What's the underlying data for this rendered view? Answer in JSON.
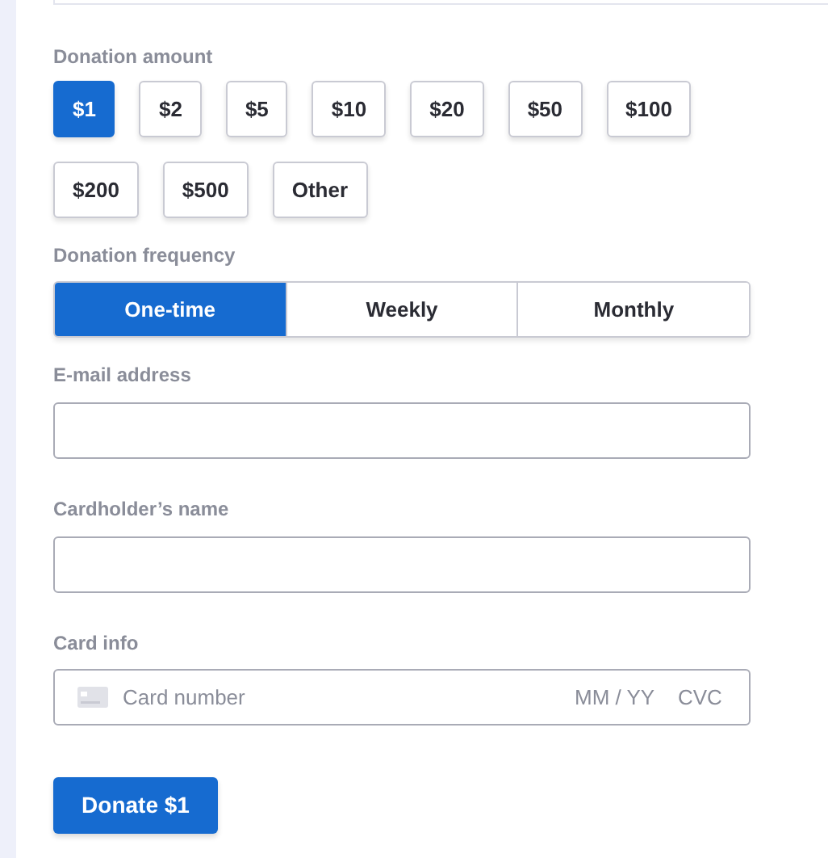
{
  "donation_amount": {
    "label": "Donation amount",
    "options": [
      {
        "label": "$1",
        "selected": true
      },
      {
        "label": "$2",
        "selected": false
      },
      {
        "label": "$5",
        "selected": false
      },
      {
        "label": "$10",
        "selected": false
      },
      {
        "label": "$20",
        "selected": false
      },
      {
        "label": "$50",
        "selected": false
      },
      {
        "label": "$100",
        "selected": false
      },
      {
        "label": "$200",
        "selected": false
      },
      {
        "label": "$500",
        "selected": false
      },
      {
        "label": "Other",
        "selected": false
      }
    ]
  },
  "donation_frequency": {
    "label": "Donation frequency",
    "options": [
      {
        "label": "One-time",
        "selected": true
      },
      {
        "label": "Weekly",
        "selected": false
      },
      {
        "label": "Monthly",
        "selected": false
      }
    ]
  },
  "email": {
    "label": "E-mail address"
  },
  "cardholder_name": {
    "label": "Cardholder’s name"
  },
  "card_info": {
    "label": "Card info",
    "card_number": {
      "placeholder": "Card number"
    },
    "expiry": {
      "placeholder": "MM / YY"
    },
    "cvc": {
      "placeholder": "CVC"
    }
  },
  "submit": {
    "label": "Donate $1"
  }
}
